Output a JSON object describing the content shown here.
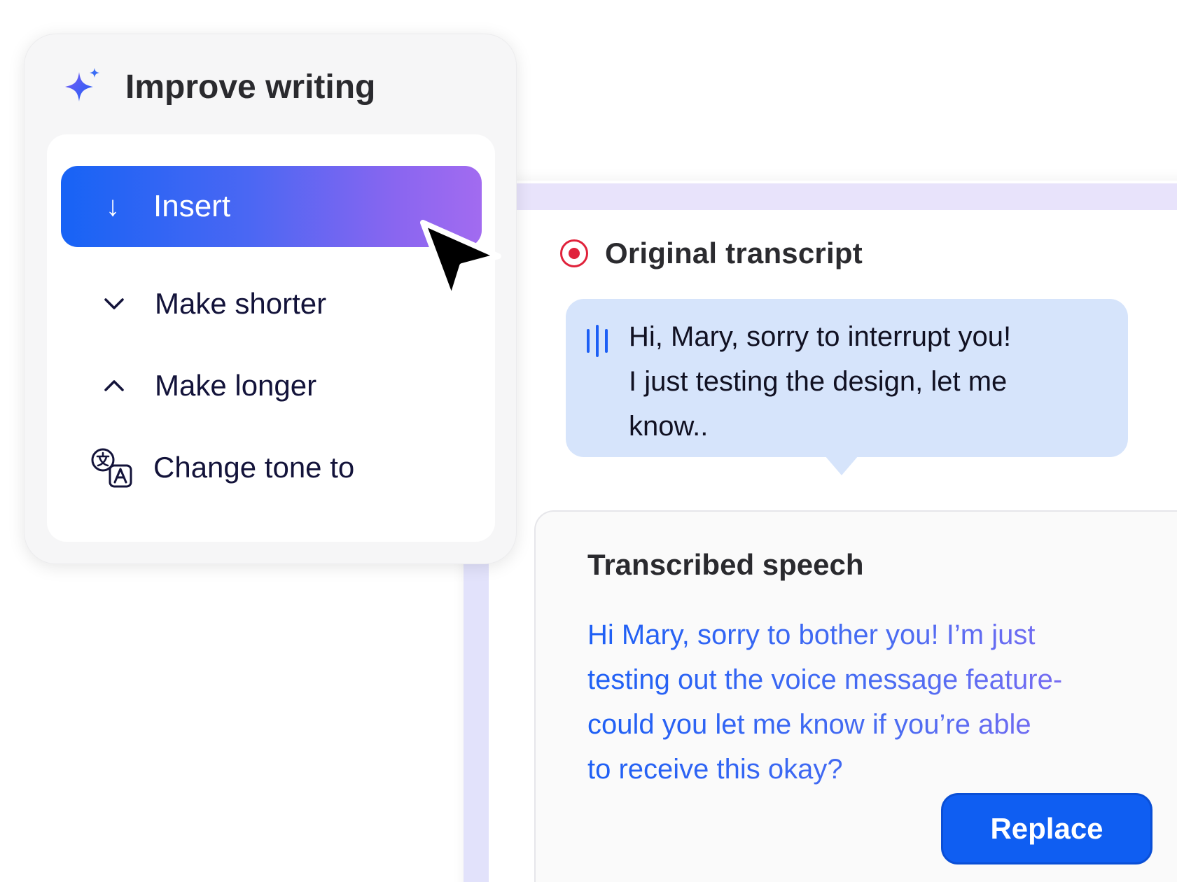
{
  "menu": {
    "title": "Improve writing",
    "icon": "sparkle-icon",
    "items": [
      {
        "label": "Insert",
        "icon": "arrow-down-icon",
        "glyph": "↓",
        "active": true
      },
      {
        "label": "Make shorter",
        "icon": "chevron-down-icon"
      },
      {
        "label": "Make longer",
        "icon": "chevron-up-icon"
      },
      {
        "label": "Change tone to",
        "icon": "translate-icon"
      }
    ]
  },
  "transcript": {
    "title": "Original transcript",
    "icon": "record-icon",
    "bubble_lines": [
      "Hi, Mary, sorry to interrupt you!",
      "I just testing the design, let me",
      "know.."
    ]
  },
  "speech": {
    "title": "Transcribed speech",
    "lines": [
      "Hi Mary, sorry to bother you! I’m just",
      "testing out the voice message feature-",
      "could you let me know if you’re able",
      "to receive this okay?"
    ],
    "replace_label": "Replace"
  },
  "colors": {
    "accent_blue": "#0f5ef2",
    "accent_purple": "#a26bf0",
    "record_red": "#e0223b",
    "bubble_bg": "#d6e4fb"
  }
}
